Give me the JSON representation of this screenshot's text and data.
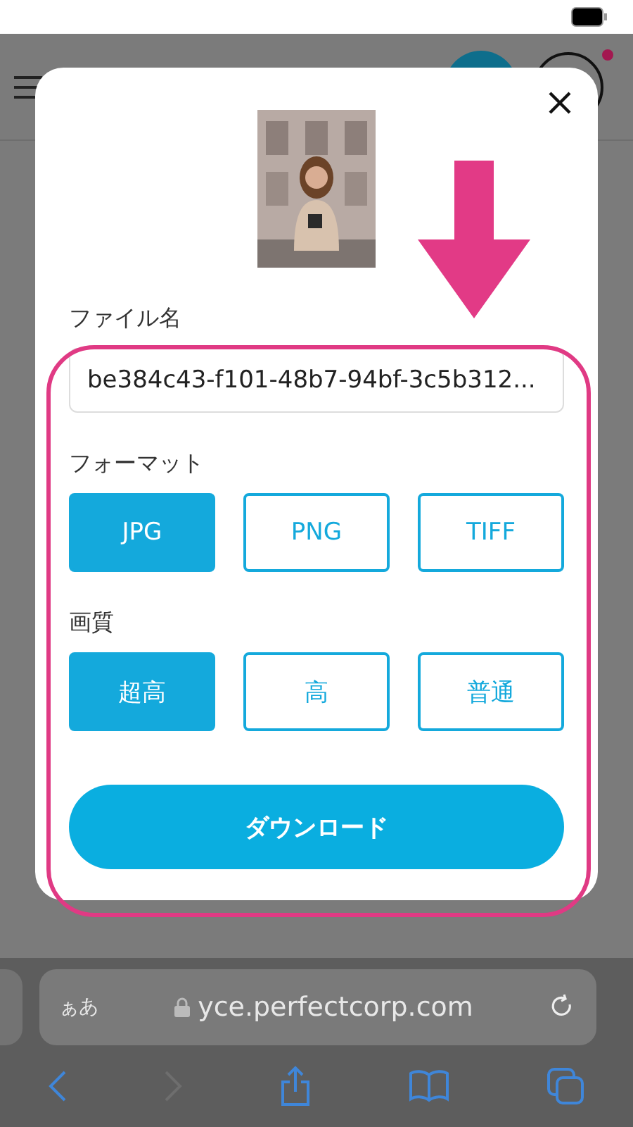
{
  "browser": {
    "text_size_label": "ぁあ",
    "url": "yce.perfectcorp.com"
  },
  "dialog": {
    "file_name": {
      "label": "ファイル名",
      "value": "be384c43-f101-48b7-94bf-3c5b312..."
    },
    "format": {
      "label": "フォーマット",
      "options": [
        {
          "label": "JPG",
          "selected": true
        },
        {
          "label": "PNG",
          "selected": false
        },
        {
          "label": "TIFF",
          "selected": false
        }
      ]
    },
    "quality": {
      "label": "画質",
      "options": [
        {
          "label": "超高",
          "selected": true
        },
        {
          "label": "高",
          "selected": false
        },
        {
          "label": "普通",
          "selected": false
        }
      ]
    },
    "download_button": "ダウンロード"
  },
  "annotation": {
    "arrow": true,
    "outline": true
  }
}
